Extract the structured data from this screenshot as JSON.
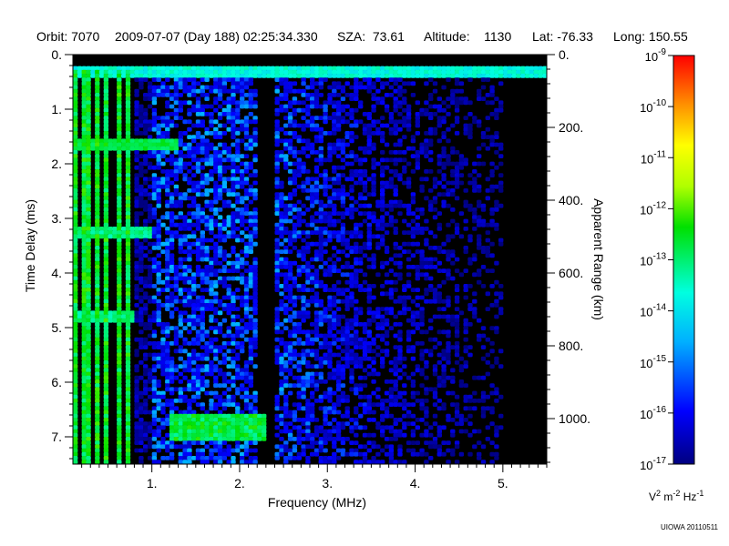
{
  "header": {
    "orbit": "Orbit: 7070",
    "datetime": "2009-07-07 (Day 188) 02:25:34.330",
    "sza": "SZA:  73.61",
    "altitude": "Altitude:    1130",
    "lat": "Lat: -76.33",
    "long": "Long: 150.55"
  },
  "credit": "UIOWA 20110511",
  "colorbar_unit": {
    "v": "V",
    "v_exp": "2",
    "m": " m",
    "m_exp": "-2",
    "hz": " Hz",
    "hz_exp": "-1"
  },
  "colors": {
    "background": "#000000",
    "low": "#0000ff",
    "mid": "#00ffff",
    "high": "#00ff00"
  },
  "chart_data": {
    "type": "heatmap",
    "title": "",
    "xlabel": "Frequency (MHz)",
    "ylabel": "Time Delay (ms)",
    "y2label": "Apparent Range (km)",
    "xlim": [
      0.1,
      5.5
    ],
    "ylim": [
      0,
      7.5
    ],
    "y_inverted": true,
    "x_ticks": [
      1,
      2,
      3,
      4,
      5
    ],
    "x_tick_labels": [
      "1.",
      "2.",
      "3.",
      "4.",
      "5."
    ],
    "y_ticks": [
      0,
      1,
      2,
      3,
      4,
      5,
      6,
      7
    ],
    "y_tick_labels": [
      "0.",
      "1.",
      "2.",
      "3.",
      "4.",
      "5.",
      "6.",
      "7."
    ],
    "y2_ticks_km": [
      0,
      200,
      400,
      600,
      800,
      1000
    ],
    "y2_tick_labels": [
      "0.",
      "200.",
      "400.",
      "600.",
      "800.",
      "1000."
    ],
    "y2_km_at_y_max": 1125,
    "colorbar": {
      "scale": "log",
      "range": [
        1e-17,
        1e-09
      ],
      "tick_values": [
        -9,
        -10,
        -11,
        -12,
        -13,
        -14,
        -15,
        -16,
        -17
      ],
      "tick_labels": [
        "10",
        "10",
        "10",
        "10",
        "10",
        "10",
        "10",
        "10",
        "10"
      ],
      "tick_exponents": [
        "-9",
        "-10",
        "-11",
        "-12",
        "-13",
        "-14",
        "-15",
        "-16",
        "-17"
      ]
    },
    "features": [
      {
        "name": "surface/early echo band",
        "delay_ms": 0.3,
        "freq_range_mhz": [
          0.1,
          5.5
        ],
        "level_log": -15.0
      },
      {
        "name": "low-frequency harmonics",
        "freq_range_mhz": [
          0.1,
          0.8
        ],
        "delay_range_ms": [
          0.3,
          7.5
        ],
        "level_log": -14.2
      },
      {
        "name": "diffuse plasma emission",
        "freq_range_mhz": [
          0.8,
          5.0
        ],
        "delay_range_ms": [
          0.4,
          7.5
        ],
        "level_log": -16.0
      },
      {
        "name": "echo trace",
        "freq_range_mhz": [
          1.2,
          2.3
        ],
        "delay_range_ms": [
          6.6,
          7.1
        ],
        "level_log": -14.3
      },
      {
        "name": "horizontal band",
        "delay_ms": 1.65,
        "freq_range_mhz": [
          0.1,
          1.3
        ],
        "level_log": -14.3
      },
      {
        "name": "horizontal band",
        "delay_ms": 3.25,
        "freq_range_mhz": [
          0.1,
          1.0
        ],
        "level_log": -14.6
      },
      {
        "name": "horizontal band",
        "delay_ms": 4.8,
        "freq_range_mhz": [
          0.1,
          0.8
        ],
        "level_log": -14.6
      }
    ]
  }
}
